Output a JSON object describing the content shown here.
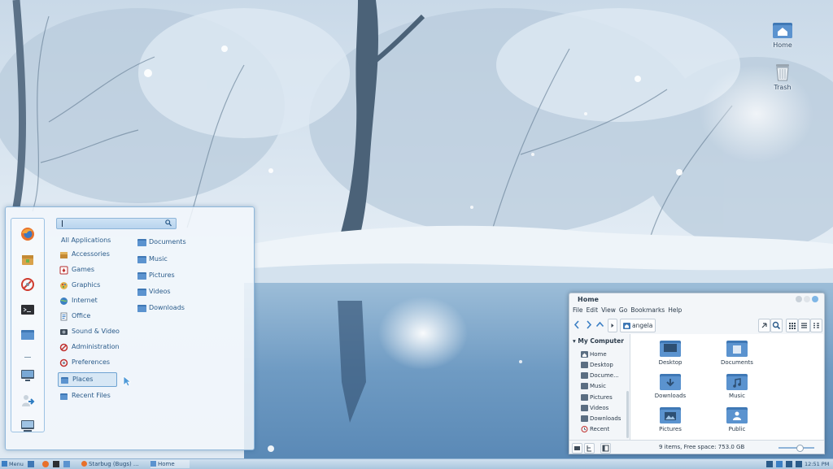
{
  "desktop": {
    "icons": [
      {
        "label": "Home"
      },
      {
        "label": "Trash"
      }
    ]
  },
  "menu": {
    "search": {
      "placeholder": "",
      "value": ""
    },
    "favorites": [
      "firefox-icon",
      "software-manager-icon",
      "system-settings-icon",
      "terminal-icon",
      "files-icon",
      "monitor-icon",
      "logout-icon",
      "computer-icon"
    ],
    "categories": [
      {
        "label": "All Applications"
      },
      {
        "label": "Accessories"
      },
      {
        "label": "Games"
      },
      {
        "label": "Graphics"
      },
      {
        "label": "Internet"
      },
      {
        "label": "Office"
      },
      {
        "label": "Sound & Video"
      },
      {
        "label": "Administration"
      },
      {
        "label": "Preferences"
      },
      {
        "label": "Places"
      },
      {
        "label": "Recent Files"
      }
    ],
    "selected_category": "Places",
    "places": [
      {
        "label": "Documents"
      },
      {
        "label": "Music"
      },
      {
        "label": "Pictures"
      },
      {
        "label": "Videos"
      },
      {
        "label": "Downloads"
      }
    ]
  },
  "file_manager": {
    "title": "Home",
    "menubar": [
      "File",
      "Edit",
      "View",
      "Go",
      "Bookmarks",
      "Help"
    ],
    "breadcrumb": "angela",
    "sidebar": {
      "header": "My Computer",
      "items": [
        {
          "label": "Home"
        },
        {
          "label": "Desktop"
        },
        {
          "label": "Docume..."
        },
        {
          "label": "Music"
        },
        {
          "label": "Pictures"
        },
        {
          "label": "Videos"
        },
        {
          "label": "Downloads"
        },
        {
          "label": "Recent"
        }
      ]
    },
    "files": [
      {
        "label": "Desktop"
      },
      {
        "label": "Documents"
      },
      {
        "label": "Downloads"
      },
      {
        "label": "Music"
      },
      {
        "label": "Pictures"
      },
      {
        "label": "Public"
      }
    ],
    "status": "9 items, Free space: 753.0 GB",
    "zoom_fraction": 0.6
  },
  "taskbar": {
    "menu_label": "Menu",
    "windows": [
      {
        "label": "Starbug (Bugs) ..."
      },
      {
        "label": "Home"
      }
    ],
    "clock": "12:51 PM"
  },
  "colors": {
    "accent": "#3b7fc4",
    "folder": "#4f86c1",
    "panel": "#b9d1e6"
  }
}
